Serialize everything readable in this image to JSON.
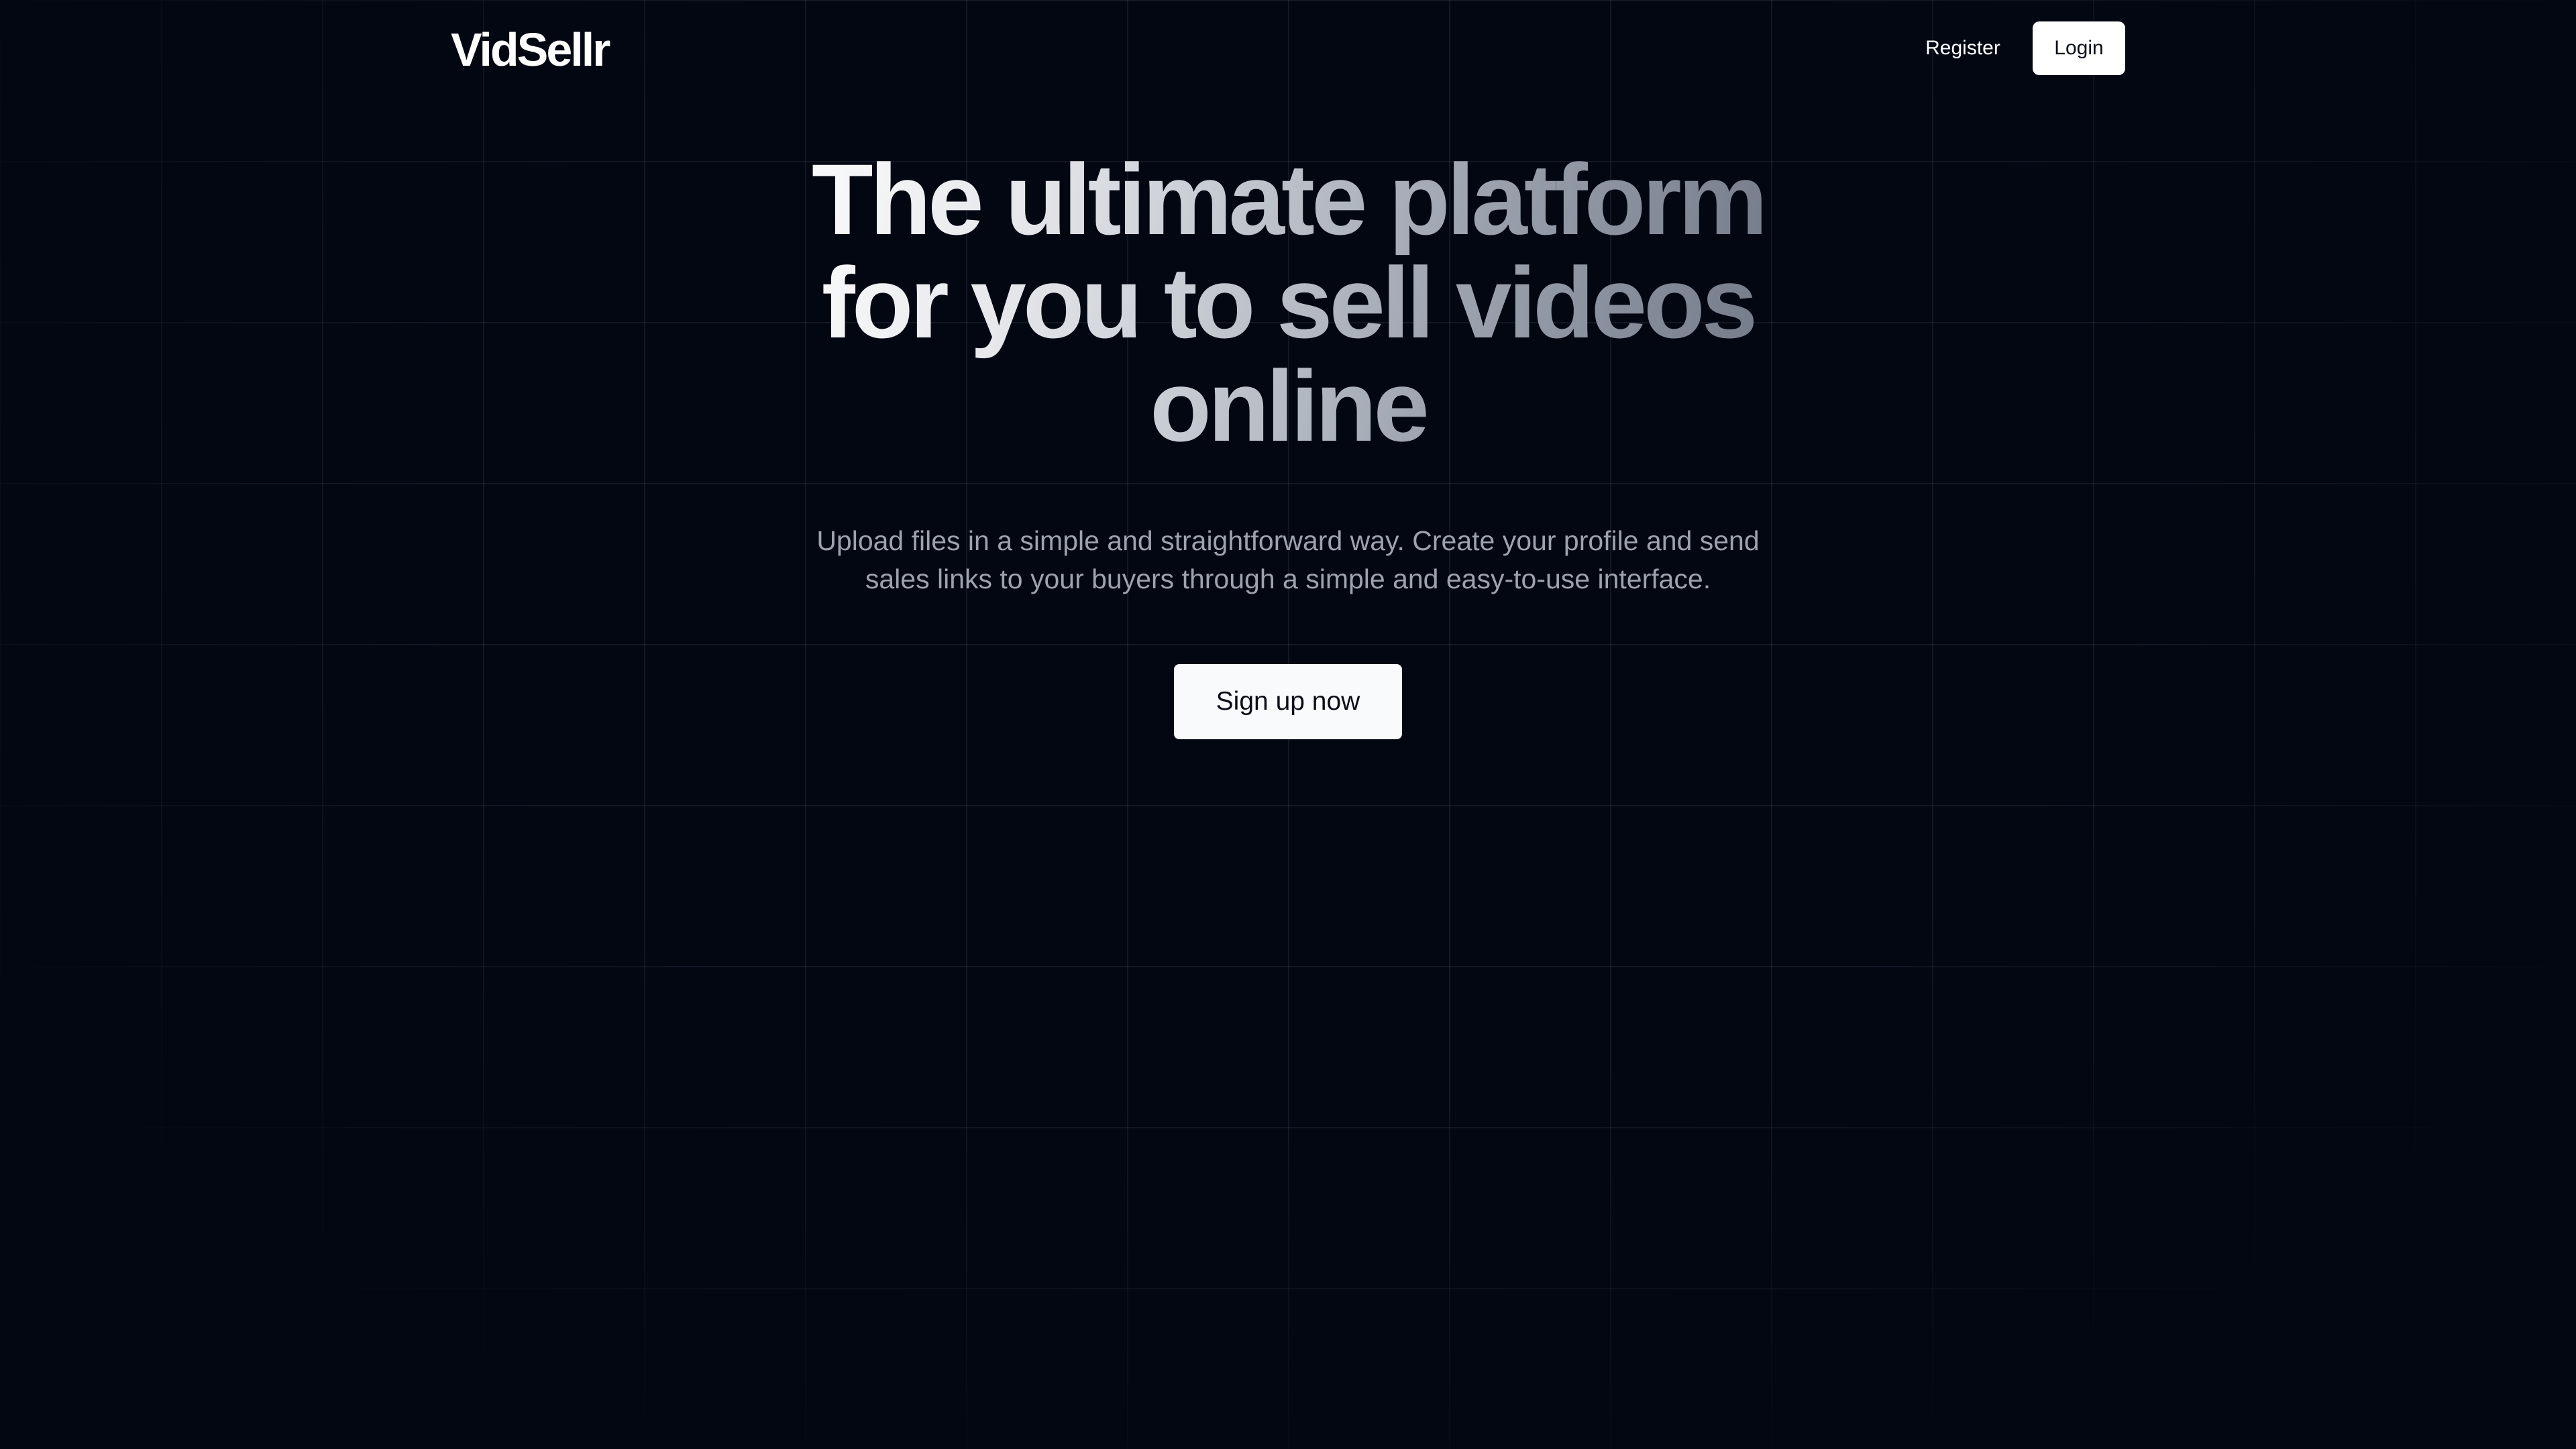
{
  "navbar": {
    "logo_text": "VidSellr",
    "register_label": "Register",
    "login_label": "Login"
  },
  "hero": {
    "title": "The ultimate platform for you to sell videos online",
    "subtitle": "Upload files in a simple and straightforward way. Create your profile and send sales links to your buyers through a simple and easy-to-use interface.",
    "cta_label": "Sign up now"
  },
  "colors": {
    "background": "#030712",
    "grid_line": "#1f2937",
    "cta_background": "#f9fafb",
    "subtitle_text": "#9ca3af"
  }
}
